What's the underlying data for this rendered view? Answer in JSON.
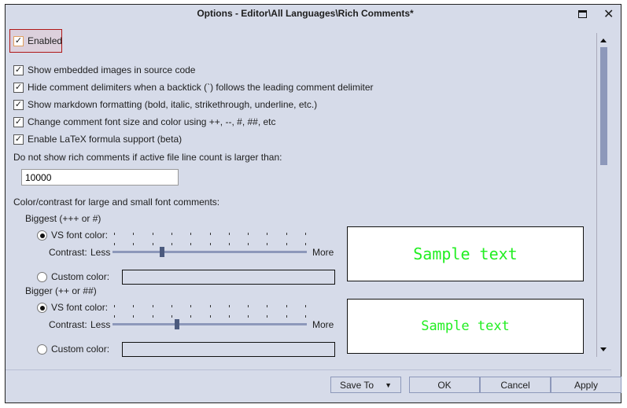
{
  "window": {
    "title": "Options - Editor\\All Languages\\Rich Comments*"
  },
  "enabled": {
    "label": "Enabled",
    "checked": true
  },
  "options": [
    {
      "label": "Show embedded images in source code",
      "checked": true
    },
    {
      "label": "Hide comment delimiters when a backtick (`) follows the leading comment delimiter",
      "checked": true
    },
    {
      "label": "Show markdown formatting (bold, italic, strikethrough, underline, etc.)",
      "checked": true
    },
    {
      "label": "Change comment font size and color using ++, --, #, ##, etc",
      "checked": true
    },
    {
      "label": "Enable LaTeX formula support (beta)",
      "checked": true
    }
  ],
  "line_count": {
    "label": "Do not show rich comments if active file line count is larger than:",
    "value": "10000"
  },
  "contrast_heading": "Color/contrast for large and small font comments:",
  "groups": [
    {
      "heading": "Biggest (+++ or #)",
      "vs_label": "VS font color:",
      "contrast_label": "Contrast:",
      "less": "Less",
      "more": "More",
      "custom_label": "Custom color:",
      "slider_value": 0.25,
      "sample": "Sample text"
    },
    {
      "heading": "Bigger (++ or ##)",
      "vs_label": "VS font color:",
      "contrast_label": "Contrast:",
      "less": "Less",
      "more": "More",
      "custom_label": "Custom color:",
      "slider_value": 0.33,
      "sample": "Sample text"
    }
  ],
  "buttons": {
    "save_to": "Save To",
    "ok": "OK",
    "cancel": "Cancel",
    "apply": "Apply"
  },
  "colors": {
    "sample_text": "#22ee22",
    "background": "#d6dbe9",
    "enabled_highlight": "#b01818"
  }
}
